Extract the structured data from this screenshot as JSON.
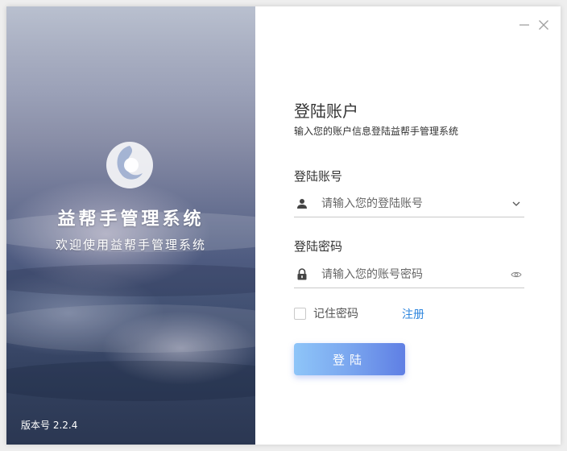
{
  "brand": {
    "title": "益帮手管理系统",
    "subtitle": "欢迎使用益帮手管理系统",
    "version": "版本号 2.2.4"
  },
  "window_controls": {
    "minimize_icon": "minimize-icon",
    "close_icon": "close-icon"
  },
  "login": {
    "heading": "登陆账户",
    "subheading": "输入您的账户信息登陆益帮手管理系统",
    "account": {
      "label": "登陆账号",
      "value": "",
      "placeholder": "请输入您的登陆账号",
      "icon": "user-icon",
      "trailing_icon": "chevron-down-icon"
    },
    "password": {
      "label": "登陆密码",
      "value": "",
      "placeholder": "请输入您的账号密码",
      "icon": "lock-icon",
      "trailing_icon": "eye-icon"
    },
    "remember_label": "记住密码",
    "remember_checked": false,
    "register_label": "注册",
    "submit_label": "登陆"
  },
  "colors": {
    "accent": "#2e86de",
    "button_gradient_start": "#8ec5f8",
    "button_gradient_end": "#5f7fe4"
  }
}
